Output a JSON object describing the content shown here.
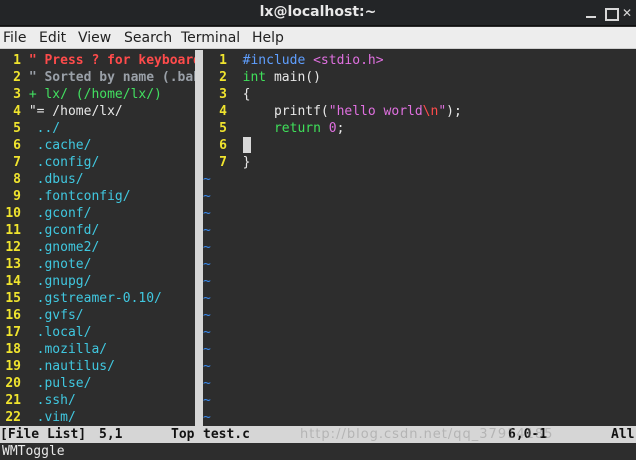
{
  "window": {
    "title": "lx@localhost:~"
  },
  "menu": [
    "File",
    "Edit",
    "View",
    "Search",
    "Terminal",
    "Help"
  ],
  "left_pane": {
    "lines": [
      {
        "n": "1",
        "text": "\" Press ? for keyboard",
        "cls": "red"
      },
      {
        "n": "2",
        "text": "\" Sorted by name (.bak",
        "cls": "grey"
      },
      {
        "n": "3",
        "text": "+ lx/ (/home/lx/)",
        "cls": "green"
      },
      {
        "n": "4",
        "text": "\"= /home/lx/",
        "cls": "white"
      },
      {
        "n": "5",
        "text": " ../",
        "cls": "dir"
      },
      {
        "n": "6",
        "text": " .cache/",
        "cls": "dir"
      },
      {
        "n": "7",
        "text": " .config/",
        "cls": "dir"
      },
      {
        "n": "8",
        "text": " .dbus/",
        "cls": "dir"
      },
      {
        "n": "9",
        "text": " .fontconfig/",
        "cls": "dir"
      },
      {
        "n": "10",
        "text": " .gconf/",
        "cls": "dir"
      },
      {
        "n": "11",
        "text": " .gconfd/",
        "cls": "dir"
      },
      {
        "n": "12",
        "text": " .gnome2/",
        "cls": "dir"
      },
      {
        "n": "13",
        "text": " .gnote/",
        "cls": "dir"
      },
      {
        "n": "14",
        "text": " .gnupg/",
        "cls": "dir"
      },
      {
        "n": "15",
        "text": " .gstreamer-0.10/",
        "cls": "dir"
      },
      {
        "n": "16",
        "text": " .gvfs/",
        "cls": "dir"
      },
      {
        "n": "17",
        "text": " .local/",
        "cls": "dir"
      },
      {
        "n": "18",
        "text": " .mozilla/",
        "cls": "dir"
      },
      {
        "n": "19",
        "text": " .nautilus/",
        "cls": "dir"
      },
      {
        "n": "20",
        "text": " .pulse/",
        "cls": "dir"
      },
      {
        "n": "21",
        "text": " .ssh/",
        "cls": "dir"
      },
      {
        "n": "22",
        "text": " .vim/",
        "cls": "dir"
      }
    ]
  },
  "editor": {
    "code": [
      {
        "n": "1",
        "segs": [
          {
            "t": "#include ",
            "c": "pp"
          },
          {
            "t": "<stdio.h>",
            "c": "inc"
          }
        ]
      },
      {
        "n": "2",
        "segs": [
          {
            "t": "int",
            "c": "kw"
          },
          {
            "t": " main()",
            "c": "white"
          }
        ]
      },
      {
        "n": "3",
        "segs": [
          {
            "t": "{",
            "c": "white"
          }
        ]
      },
      {
        "n": "4",
        "segs": [
          {
            "t": "    printf(",
            "c": "white"
          },
          {
            "t": "\"hello world",
            "c": "str"
          },
          {
            "t": "\\n",
            "c": "esc"
          },
          {
            "t": "\"",
            "c": "str"
          },
          {
            "t": ");",
            "c": "white"
          }
        ]
      },
      {
        "n": "5",
        "segs": [
          {
            "t": "    ",
            "c": "white"
          },
          {
            "t": "return",
            "c": "kw"
          },
          {
            "t": " ",
            "c": "white"
          },
          {
            "t": "0",
            "c": "num"
          },
          {
            "t": ";",
            "c": "white"
          }
        ]
      },
      {
        "n": "6",
        "segs": [],
        "cursor": true
      },
      {
        "n": "7",
        "segs": [
          {
            "t": "}",
            "c": "white"
          }
        ]
      }
    ],
    "empty_marker": "~",
    "empty_count": 15
  },
  "status": {
    "left_name": "[File List]",
    "left_pos": "5,1",
    "left_scroll": "Top",
    "right_name": "test.c",
    "right_pos": "6,0-1",
    "right_scroll": "All"
  },
  "cmdline": "WMToggle",
  "watermark": "http://blog.csdn.net/qq_37914185"
}
